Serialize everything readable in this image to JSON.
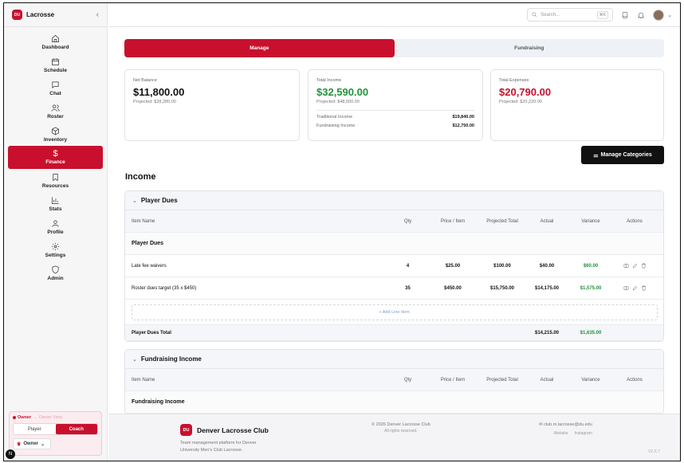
{
  "sidebar": {
    "brand": "Lacrosse",
    "logo_text": "DU",
    "collapse_glyph": "‹",
    "items": [
      {
        "label": "Dashboard",
        "icon": "home-icon"
      },
      {
        "label": "Schedule",
        "icon": "calendar-icon"
      },
      {
        "label": "Chat",
        "icon": "chat-icon"
      },
      {
        "label": "Roster",
        "icon": "users-icon"
      },
      {
        "label": "Inventory",
        "icon": "box-icon"
      },
      {
        "label": "Finance",
        "icon": "dollar-icon",
        "active": true
      },
      {
        "label": "Resources",
        "icon": "bookmark-icon"
      },
      {
        "label": "Stats",
        "icon": "chart-icon"
      },
      {
        "label": "Profile",
        "icon": "user-icon"
      },
      {
        "label": "Settings",
        "icon": "gear-icon"
      },
      {
        "label": "Admin",
        "icon": "shield-icon"
      }
    ],
    "role": {
      "owner_label": "Owner",
      "view_label": "Owner View",
      "player": "Player",
      "coach": "Coach",
      "selector": "Owner"
    },
    "badge": "N"
  },
  "topbar": {
    "search_placeholder": "Search...",
    "shortcut": "⌘K"
  },
  "tabs": {
    "manage": "Manage",
    "fundraising": "Fundraising"
  },
  "cards": {
    "net": {
      "label": "Net Balance",
      "value": "$11,800.00",
      "projected": "Projected: $28,280.00"
    },
    "income": {
      "label": "Total Income",
      "value": "$32,590.00",
      "projected": "Projected: $48,500.00",
      "traditional_label": "Traditional Income",
      "traditional_value": "$19,840.00",
      "fundraising_label": "Fundraising Income",
      "fundraising_value": "$12,750.00"
    },
    "expenses": {
      "label": "Total Expenses",
      "value": "$20,790.00",
      "projected": "Projected: $20,220.00"
    }
  },
  "manage_categories": "Manage Categories",
  "income_title": "Income",
  "columns": {
    "name": "Item Name",
    "qty": "Qty",
    "price": "Price / Item",
    "projected": "Projected Total",
    "actual": "Actual",
    "variance": "Variance",
    "actions": "Actions"
  },
  "player_dues": {
    "title": "Player Dues",
    "group": "Player Dues",
    "rows": [
      {
        "name": "Late fee waivers",
        "qty": "4",
        "price": "$25.00",
        "projected": "$100.00",
        "actual": "$40.00",
        "variance": "$60.00"
      },
      {
        "name": "Roster dues target (35 x $450)",
        "qty": "35",
        "price": "$450.00",
        "projected": "$15,750.00",
        "actual": "$14,175.00",
        "variance": "$1,575.00"
      }
    ],
    "add_line": "+ Add Line Item",
    "total_label": "Player Dues Total",
    "total_actual": "$14,215.00",
    "total_variance": "$1,635.00"
  },
  "fundraising": {
    "title": "Fundraising Income",
    "group": "Fundraising Income"
  },
  "footer": {
    "club": "Denver Lacrosse Club",
    "desc": "Team management platform for Denver University Men's Club Lacrosse.",
    "copyright": "© 2026 Denver Lacrosse Club",
    "rights": "All rights reserved.",
    "email": "club.m.lacrosse@du.edu",
    "website": "Website",
    "instagram": "Instagram",
    "version": "V2.X.7"
  },
  "colors": {
    "accent": "#c8102e",
    "positive": "#23913d"
  }
}
